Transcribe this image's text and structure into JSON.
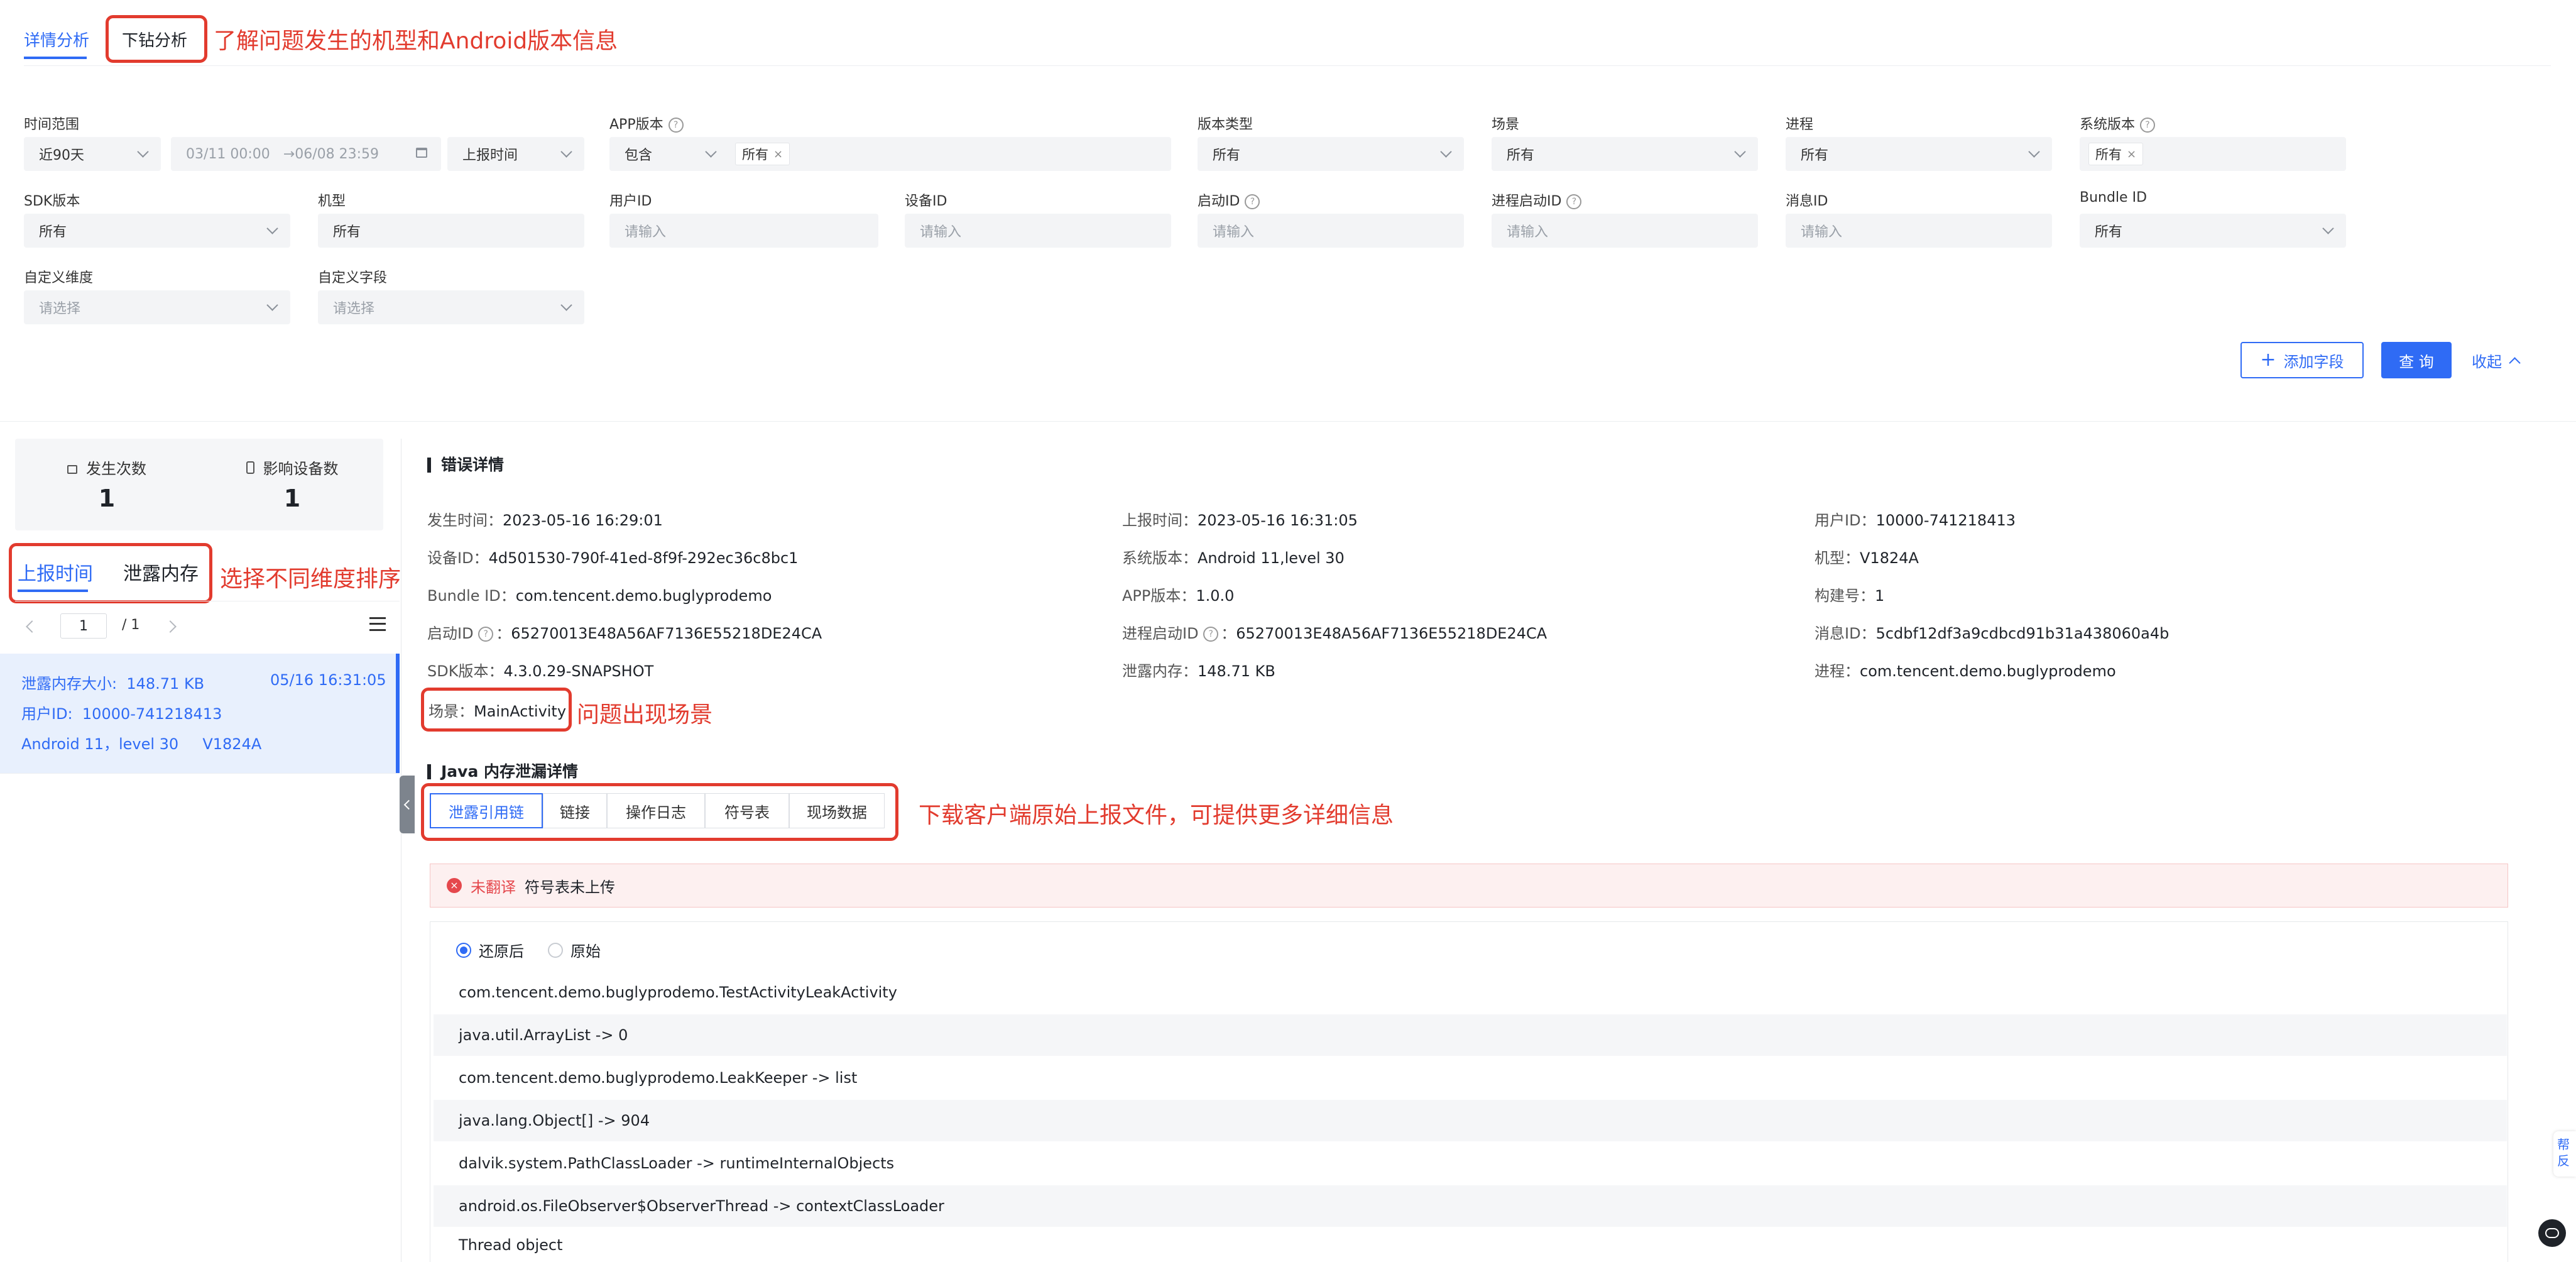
{
  "top_tabs": [
    {
      "label": "详情分析",
      "active": true
    },
    {
      "label": "下钻分析",
      "active": false
    }
  ],
  "annotations": {
    "top": "了解问题发生的机型和Android版本信息",
    "sort": "选择不同维度排序",
    "scene": "问题出现场景",
    "download": "下载客户端原始上报文件，可提供更多详细信息"
  },
  "filters": {
    "time_range": {
      "label": "时间范围",
      "value": "近90天",
      "date_start": "03/11 00:00",
      "date_end": "→06/08 23:59",
      "time_type": "上报时间"
    },
    "app_version": {
      "label": "APP版本",
      "op": "包含",
      "tag": "所有"
    },
    "version_type": {
      "label": "版本类型",
      "value": "所有"
    },
    "scene": {
      "label": "场景",
      "value": "所有"
    },
    "process": {
      "label": "进程",
      "value": "所有"
    },
    "system_version": {
      "label": "系统版本",
      "tag": "所有"
    },
    "sdk_version": {
      "label": "SDK版本",
      "value": "所有"
    },
    "model": {
      "label": "机型",
      "value": "所有"
    },
    "user_id": {
      "label": "用户ID",
      "placeholder": "请输入"
    },
    "device_id": {
      "label": "设备ID",
      "placeholder": "请输入"
    },
    "launch_id": {
      "label": "启动ID",
      "placeholder": "请输入"
    },
    "process_launch_id": {
      "label": "进程启动ID",
      "placeholder": "请输入"
    },
    "message_id": {
      "label": "消息ID",
      "placeholder": "请输入"
    },
    "bundle_id": {
      "label": "Bundle ID",
      "value": "所有"
    },
    "custom_dim": {
      "label": "自定义维度",
      "placeholder": "请选择"
    },
    "custom_field": {
      "label": "自定义字段",
      "placeholder": "请选择"
    }
  },
  "actions": {
    "add_field": "添加字段",
    "query": "查 询",
    "collapse": "收起"
  },
  "stats": {
    "occurrences_label": "发生次数",
    "occurrences": "1",
    "devices_label": "影响设备数",
    "devices": "1"
  },
  "sort_tabs": [
    {
      "label": "上报时间",
      "active": true
    },
    {
      "label": "泄露内存",
      "active": false
    }
  ],
  "pager": {
    "current": "1",
    "total": "/ 1"
  },
  "record": {
    "size": "泄露内存大小:  148.71 KB",
    "time": "05/16 16:31:05",
    "user": "用户ID:  10000-741218413",
    "device": "Android 11，level 30     V1824A"
  },
  "error_detail": {
    "title": "错误详情",
    "rows": [
      [
        "发生时间：",
        "2023-05-16 16:29:01",
        "上报时间：",
        "2023-05-16 16:31:05",
        "用户ID：",
        "10000-741218413"
      ],
      [
        "设备ID：",
        "4d501530-790f-41ed-8f9f-292ec36c8bc1",
        "系统版本：",
        "Android 11,level 30",
        "机型：",
        "V1824A"
      ],
      [
        "Bundle ID：",
        "com.tencent.demo.buglyprodemo",
        "APP版本：",
        "1.0.0",
        "构建号：",
        "1"
      ],
      [
        "启动ID ",
        "65270013E48A56AF7136E55218DE24CA",
        "进程启动ID ",
        "65270013E48A56AF7136E55218DE24CA",
        "消息ID：",
        "5cdbf12df3a9cdbcd91b31a438060a4b"
      ],
      [
        "SDK版本：",
        "4.3.0.29-SNAPSHOT",
        "泄露内存：",
        "148.71 KB",
        "进程：",
        "com.tencent.demo.buglyprodemo"
      ]
    ],
    "scene_label": "场景：",
    "scene_value": "MainActivity"
  },
  "leak": {
    "title": "Java 内存泄漏详情",
    "tabs": [
      "泄露引用链",
      "链接",
      "操作日志",
      "符号表",
      "现场数据"
    ],
    "alert_tag": "未翻译",
    "alert_text": "符号表未上传",
    "radio_restored": "还原后",
    "radio_raw": "原始",
    "stack": [
      "com.tencent.demo.buglyprodemo.TestActivityLeakActivity",
      "java.util.ArrayList -> 0",
      "com.tencent.demo.buglyprodemo.LeakKeeper -> list",
      "java.lang.Object[] -> 904",
      "dalvik.system.PathClassLoader -> runtimeInternalObjects",
      "android.os.FileObserver$ObserverThread -> contextClassLoader",
      "Thread object"
    ]
  },
  "side_float": "帮反",
  "colors": {
    "primary": "#2f6bf5",
    "annotation": "#e23b2e",
    "alert_bg": "#fdf0f0"
  }
}
